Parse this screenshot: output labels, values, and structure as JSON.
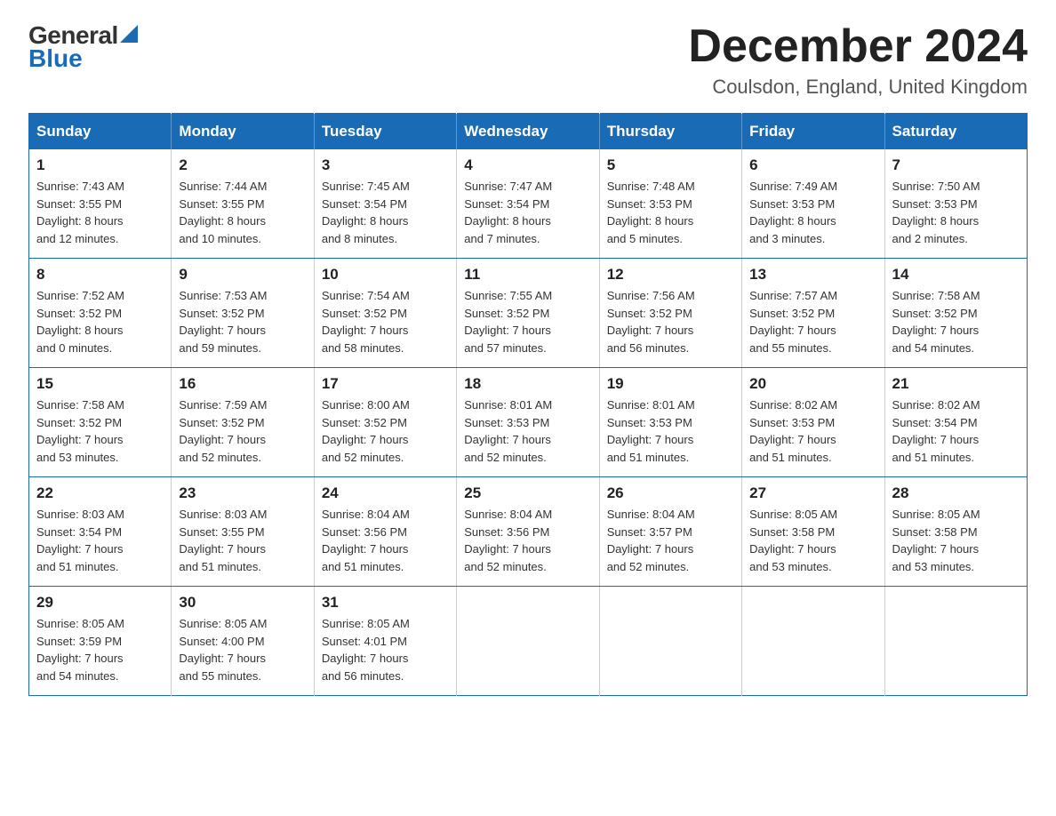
{
  "logo": {
    "general": "General",
    "blue": "Blue",
    "triangle": "▶"
  },
  "title": "December 2024",
  "subtitle": "Coulsdon, England, United Kingdom",
  "headers": [
    "Sunday",
    "Monday",
    "Tuesday",
    "Wednesday",
    "Thursday",
    "Friday",
    "Saturday"
  ],
  "weeks": [
    [
      {
        "day": "1",
        "info": "Sunrise: 7:43 AM\nSunset: 3:55 PM\nDaylight: 8 hours\nand 12 minutes."
      },
      {
        "day": "2",
        "info": "Sunrise: 7:44 AM\nSunset: 3:55 PM\nDaylight: 8 hours\nand 10 minutes."
      },
      {
        "day": "3",
        "info": "Sunrise: 7:45 AM\nSunset: 3:54 PM\nDaylight: 8 hours\nand 8 minutes."
      },
      {
        "day": "4",
        "info": "Sunrise: 7:47 AM\nSunset: 3:54 PM\nDaylight: 8 hours\nand 7 minutes."
      },
      {
        "day": "5",
        "info": "Sunrise: 7:48 AM\nSunset: 3:53 PM\nDaylight: 8 hours\nand 5 minutes."
      },
      {
        "day": "6",
        "info": "Sunrise: 7:49 AM\nSunset: 3:53 PM\nDaylight: 8 hours\nand 3 minutes."
      },
      {
        "day": "7",
        "info": "Sunrise: 7:50 AM\nSunset: 3:53 PM\nDaylight: 8 hours\nand 2 minutes."
      }
    ],
    [
      {
        "day": "8",
        "info": "Sunrise: 7:52 AM\nSunset: 3:52 PM\nDaylight: 8 hours\nand 0 minutes."
      },
      {
        "day": "9",
        "info": "Sunrise: 7:53 AM\nSunset: 3:52 PM\nDaylight: 7 hours\nand 59 minutes."
      },
      {
        "day": "10",
        "info": "Sunrise: 7:54 AM\nSunset: 3:52 PM\nDaylight: 7 hours\nand 58 minutes."
      },
      {
        "day": "11",
        "info": "Sunrise: 7:55 AM\nSunset: 3:52 PM\nDaylight: 7 hours\nand 57 minutes."
      },
      {
        "day": "12",
        "info": "Sunrise: 7:56 AM\nSunset: 3:52 PM\nDaylight: 7 hours\nand 56 minutes."
      },
      {
        "day": "13",
        "info": "Sunrise: 7:57 AM\nSunset: 3:52 PM\nDaylight: 7 hours\nand 55 minutes."
      },
      {
        "day": "14",
        "info": "Sunrise: 7:58 AM\nSunset: 3:52 PM\nDaylight: 7 hours\nand 54 minutes."
      }
    ],
    [
      {
        "day": "15",
        "info": "Sunrise: 7:58 AM\nSunset: 3:52 PM\nDaylight: 7 hours\nand 53 minutes."
      },
      {
        "day": "16",
        "info": "Sunrise: 7:59 AM\nSunset: 3:52 PM\nDaylight: 7 hours\nand 52 minutes."
      },
      {
        "day": "17",
        "info": "Sunrise: 8:00 AM\nSunset: 3:52 PM\nDaylight: 7 hours\nand 52 minutes."
      },
      {
        "day": "18",
        "info": "Sunrise: 8:01 AM\nSunset: 3:53 PM\nDaylight: 7 hours\nand 52 minutes."
      },
      {
        "day": "19",
        "info": "Sunrise: 8:01 AM\nSunset: 3:53 PM\nDaylight: 7 hours\nand 51 minutes."
      },
      {
        "day": "20",
        "info": "Sunrise: 8:02 AM\nSunset: 3:53 PM\nDaylight: 7 hours\nand 51 minutes."
      },
      {
        "day": "21",
        "info": "Sunrise: 8:02 AM\nSunset: 3:54 PM\nDaylight: 7 hours\nand 51 minutes."
      }
    ],
    [
      {
        "day": "22",
        "info": "Sunrise: 8:03 AM\nSunset: 3:54 PM\nDaylight: 7 hours\nand 51 minutes."
      },
      {
        "day": "23",
        "info": "Sunrise: 8:03 AM\nSunset: 3:55 PM\nDaylight: 7 hours\nand 51 minutes."
      },
      {
        "day": "24",
        "info": "Sunrise: 8:04 AM\nSunset: 3:56 PM\nDaylight: 7 hours\nand 51 minutes."
      },
      {
        "day": "25",
        "info": "Sunrise: 8:04 AM\nSunset: 3:56 PM\nDaylight: 7 hours\nand 52 minutes."
      },
      {
        "day": "26",
        "info": "Sunrise: 8:04 AM\nSunset: 3:57 PM\nDaylight: 7 hours\nand 52 minutes."
      },
      {
        "day": "27",
        "info": "Sunrise: 8:05 AM\nSunset: 3:58 PM\nDaylight: 7 hours\nand 53 minutes."
      },
      {
        "day": "28",
        "info": "Sunrise: 8:05 AM\nSunset: 3:58 PM\nDaylight: 7 hours\nand 53 minutes."
      }
    ],
    [
      {
        "day": "29",
        "info": "Sunrise: 8:05 AM\nSunset: 3:59 PM\nDaylight: 7 hours\nand 54 minutes."
      },
      {
        "day": "30",
        "info": "Sunrise: 8:05 AM\nSunset: 4:00 PM\nDaylight: 7 hours\nand 55 minutes."
      },
      {
        "day": "31",
        "info": "Sunrise: 8:05 AM\nSunset: 4:01 PM\nDaylight: 7 hours\nand 56 minutes."
      },
      {
        "day": "",
        "info": ""
      },
      {
        "day": "",
        "info": ""
      },
      {
        "day": "",
        "info": ""
      },
      {
        "day": "",
        "info": ""
      }
    ]
  ]
}
